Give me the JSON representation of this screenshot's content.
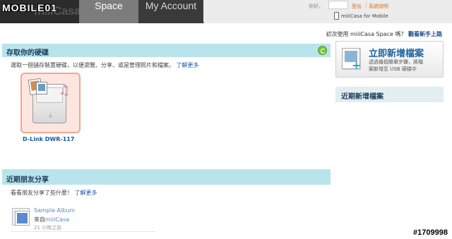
{
  "watermark": {
    "top_left": "MOBILE01",
    "bottom_right": "#1709998"
  },
  "header": {
    "logo_text": "miiiCasa",
    "tabs": [
      {
        "label": "Space",
        "active": true
      },
      {
        "label": "My Account",
        "active": false
      }
    ],
    "user": {
      "greeting": "你好，",
      "logout": "登出",
      "help": "系統說明",
      "mobile_link": "miiiCasa for Mobile"
    }
  },
  "first_use": {
    "prefix": "初次使用 miiiCasa Space 嗎？",
    "tutorial_link": "觀看新手上路"
  },
  "storage": {
    "title": "存取你的硬碟",
    "description": "選取一個儲存裝置硬碟，以便瀏覽、分享、或是管理照片和檔案。",
    "learn_more": "了解更多",
    "devices": [
      {
        "name": "D-Link DWR-117"
      }
    ]
  },
  "friends": {
    "title": "近期朋友分享",
    "description": "看看朋友分享了些什麼！",
    "learn_more": "了解更多",
    "items": [
      {
        "title": "Sample Album",
        "from_label": "來自",
        "owner": "miiiCasa",
        "time": "21 小時之前"
      }
    ]
  },
  "sidebar": {
    "add_files": {
      "title": "立即新增檔案",
      "line1": "透過幾個簡單步驟，將檔",
      "line2": "案新增至 USB 硬碟中"
    },
    "recent_files_title": "近期新增檔案"
  },
  "colors": {
    "section_header": "#b9e4ec",
    "link": "#1a56a8",
    "device_card": "#fde6e0"
  }
}
